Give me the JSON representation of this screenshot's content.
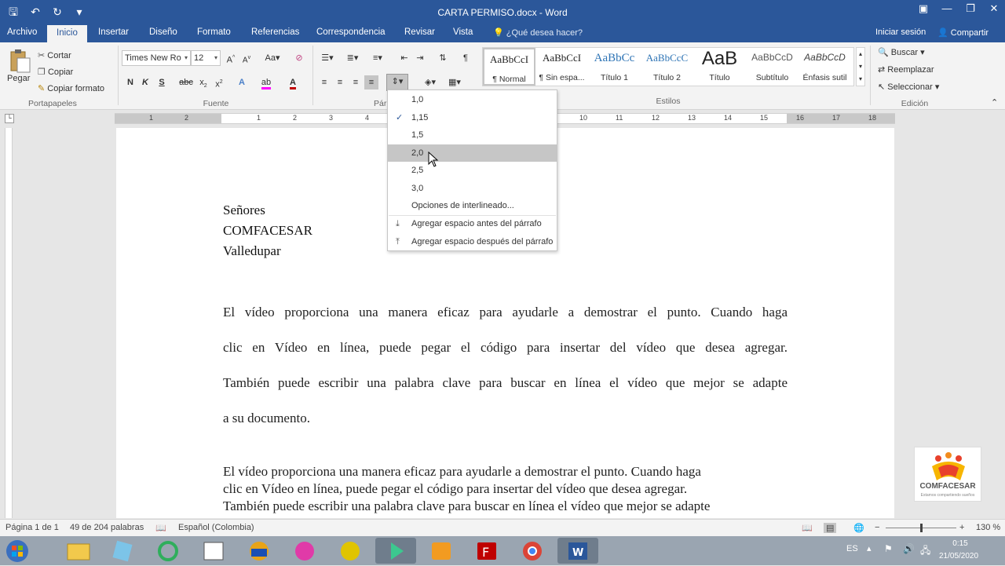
{
  "app": {
    "title": "CARTA PERMISO.docx - Word"
  },
  "menu": {
    "tabs": [
      "Archivo",
      "Inicio",
      "Insertar",
      "Diseño",
      "Formato",
      "Referencias",
      "Correspondencia",
      "Revisar",
      "Vista"
    ],
    "tell_me": "¿Qué desea hacer?",
    "sign_in": "Iniciar sesión",
    "share": "Compartir"
  },
  "ribbon": {
    "clipboard": {
      "paste": "Pegar",
      "cut": "Cortar",
      "copy": "Copiar",
      "format_painter": "Copiar formato",
      "label": "Portapapeles"
    },
    "font": {
      "name": "Times New Ro",
      "size": "12",
      "label": "Fuente"
    },
    "paragraph": {
      "label": "Pár"
    },
    "styles": {
      "items": [
        {
          "sample": "AaBbCcI",
          "name": "¶ Normal"
        },
        {
          "sample": "AaBbCcI",
          "name": "¶ Sin espa..."
        },
        {
          "sample": "AaBbCc",
          "name": "Título 1"
        },
        {
          "sample": "AaBbCcC",
          "name": "Título 2"
        },
        {
          "sample": "AaB",
          "name": "Título"
        },
        {
          "sample": "AaBbCcD",
          "name": "Subtítulo"
        },
        {
          "sample": "AaBbCcD",
          "name": "Énfasis sutil"
        }
      ],
      "label": "Estilos"
    },
    "editing": {
      "find": "Buscar",
      "replace": "Reemplazar",
      "select": "Seleccionar",
      "label": "Edición"
    }
  },
  "ruler": {
    "numbers": [
      "1",
      "2",
      "1",
      "1",
      "2",
      "3",
      "4",
      "10",
      "11",
      "12",
      "13",
      "14",
      "15",
      "16",
      "17",
      "18"
    ]
  },
  "line_spacing_menu": {
    "options": [
      "1,0",
      "1,15",
      "1,5",
      "2,0",
      "2,5",
      "3,0"
    ],
    "checked": "1,15",
    "hovered": "2,0",
    "more_options": "Opciones de interlineado...",
    "add_before": "Agregar espacio antes del párrafo",
    "add_after": "Agregar espacio después del párrafo"
  },
  "document": {
    "address": [
      "Señores",
      "COMFACESAR",
      "Valledupar"
    ],
    "para1_lines": [
      "El vídeo proporciona una manera eficaz para ayudarle a demostrar el punto. Cuando haga",
      "clic en Vídeo en línea, puede pegar el código para insertar del vídeo que desea agregar.",
      "También puede escribir una palabra clave para buscar en línea el vídeo que mejor se adapte",
      "a su documento."
    ],
    "para2_lines": [
      "El vídeo proporciona una manera eficaz para ayudarle a demostrar el punto. Cuando haga",
      "clic en Vídeo en línea, puede pegar el código para insertar del vídeo que desea agregar.",
      "También puede escribir una palabra clave para buscar en línea el vídeo que mejor se adapte"
    ]
  },
  "logo": {
    "name": "COMFACESAR",
    "tagline": "Estamos compartiendo sueños"
  },
  "status": {
    "page": "Página 1 de 1",
    "words": "49 de 204 palabras",
    "language": "Español (Colombia)",
    "zoom": "130 %"
  },
  "taskbar": {
    "lang": "ES",
    "time": "0:15",
    "date": "21/05/2020"
  },
  "colors": {
    "accent": "#2b579a",
    "highlight": "#ff00ff",
    "font_color": "#c00000"
  }
}
